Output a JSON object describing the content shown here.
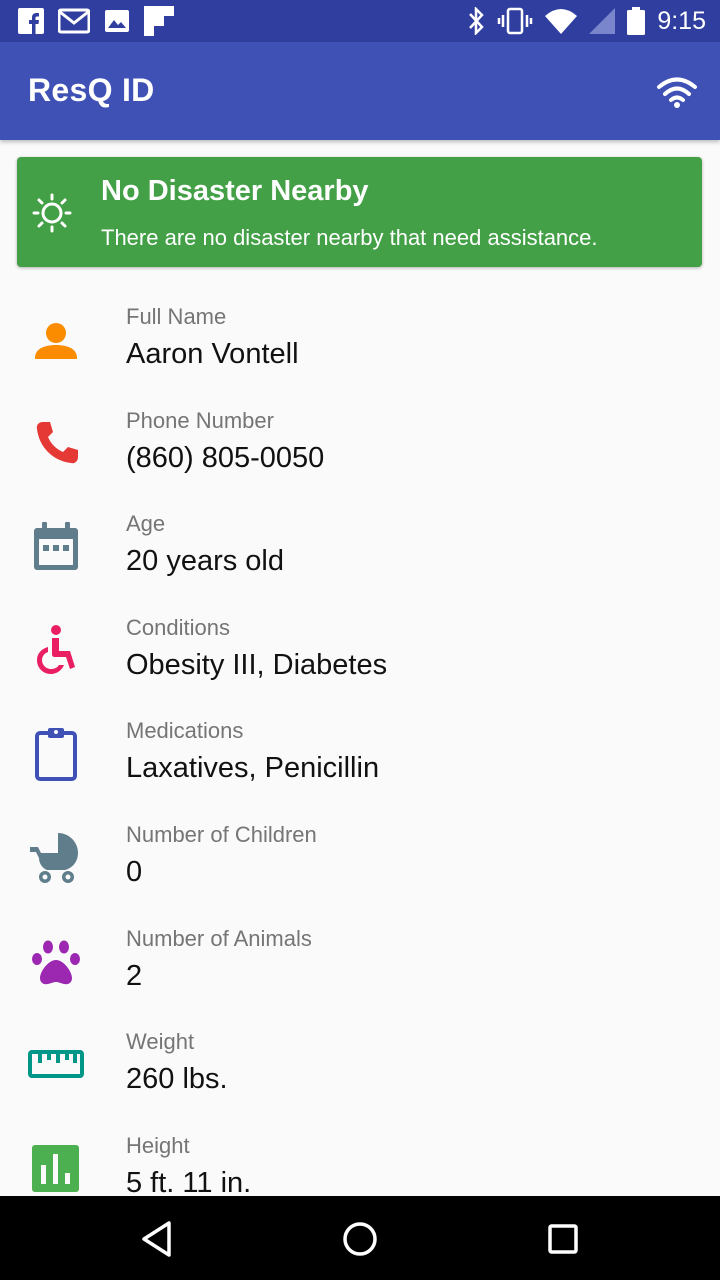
{
  "status_bar": {
    "time": "9:15",
    "left_icons": [
      "facebook-icon",
      "gmail-icon",
      "photos-icon",
      "flipboard-icon"
    ],
    "right_icons": [
      "bluetooth-icon",
      "vibrate-icon",
      "wifi-signal-icon",
      "cell-signal-icon",
      "battery-icon"
    ]
  },
  "app_bar": {
    "title": "ResQ ID",
    "action_icon": "wifi-icon"
  },
  "banner": {
    "icon": "sun-icon",
    "title": "No Disaster Nearby",
    "text": "There are no disaster nearby that need assistance.",
    "color": "#43a047"
  },
  "profile": {
    "items": [
      {
        "icon": "person-icon",
        "icon_color": "#fb8c00",
        "label": "Full Name",
        "value": "Aaron Vontell"
      },
      {
        "icon": "phone-icon",
        "icon_color": "#e53935",
        "label": "Phone Number",
        "value": "(860) 805-0050"
      },
      {
        "icon": "calendar-icon",
        "icon_color": "#607d8b",
        "label": "Age",
        "value": "20 years old"
      },
      {
        "icon": "wheelchair-icon",
        "icon_color": "#e91e63",
        "label": "Conditions",
        "value": "Obesity III, Diabetes"
      },
      {
        "icon": "clipboard-icon",
        "icon_color": "#3f51b5",
        "label": "Medications",
        "value": "Laxatives, Penicillin"
      },
      {
        "icon": "stroller-icon",
        "icon_color": "#607d8b",
        "label": "Number of Children",
        "value": "0"
      },
      {
        "icon": "paw-icon",
        "icon_color": "#9c27b0",
        "label": "Number of Animals",
        "value": "2"
      },
      {
        "icon": "ruler-icon",
        "icon_color": "#009688",
        "label": "Weight",
        "value": "260 lbs."
      },
      {
        "icon": "bar-chart-icon",
        "icon_color": "#4caf50",
        "label": "Height",
        "value": "5 ft. 11 in."
      }
    ]
  },
  "nav_bar": {
    "buttons": [
      "back-icon",
      "home-icon",
      "recents-icon"
    ]
  },
  "colors": {
    "primary": "#3f51b5",
    "primary_dark": "#303f9f",
    "background": "#fafafa"
  }
}
